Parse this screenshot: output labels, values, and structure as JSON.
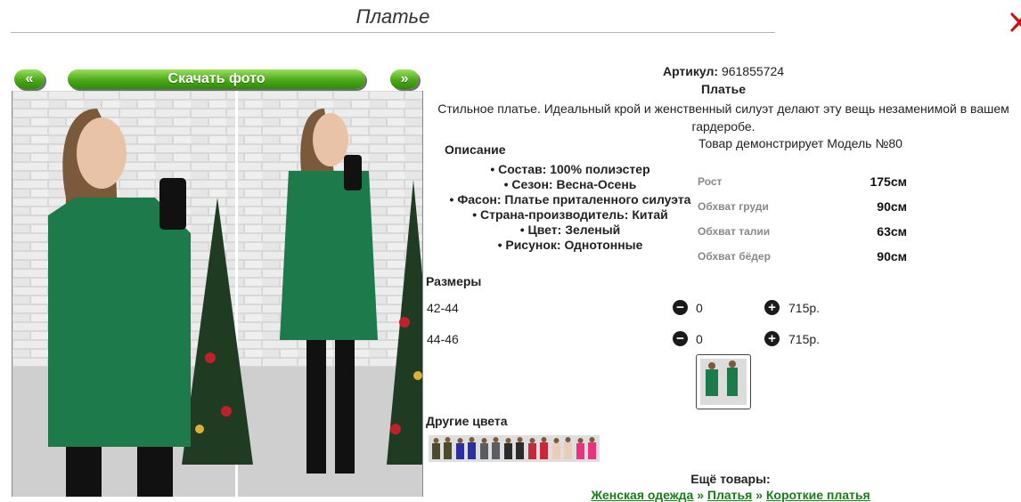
{
  "page": {
    "title": "Платье"
  },
  "photo_nav": {
    "prev_label": "«",
    "download_label": "Скачать фото",
    "next_label": "»"
  },
  "product": {
    "sku_label": "Артикул:",
    "sku_value": "961855724",
    "name": "Платье",
    "description": "Стильное платье. Идеальный крой и женственный силуэт делают эту вещь незаменимой в вашем гардеробе."
  },
  "details": {
    "title": "Описание",
    "features": [
      "Состав: 100% полиэстер",
      "Сезон: Весна-Осень",
      "Фасон: Платье приталенного силуэта",
      "Страна-производитель: Китай",
      "Цвет: Зеленый",
      "Рисунок: Однотонные"
    ]
  },
  "model": {
    "note": "Товар демонстрирует Модель №80",
    "measurements": [
      {
        "label": "Рост",
        "value": "175см"
      },
      {
        "label": "Обхват груди",
        "value": "90см"
      },
      {
        "label": "Обхват талии",
        "value": "63см"
      },
      {
        "label": "Обхват бёдер",
        "value": "90см"
      }
    ]
  },
  "sizes": {
    "title": "Размеры",
    "rows": [
      {
        "name": "42-44",
        "minus": "−",
        "qty": "0",
        "plus": "+",
        "price": "715р."
      },
      {
        "name": "44-46",
        "minus": "−",
        "qty": "0",
        "plus": "+",
        "price": "715р."
      }
    ]
  },
  "other_colors": {
    "title": "Другие цвета",
    "colors": [
      "#4b4a2c",
      "#2b2fa0",
      "#5a5d62",
      "#2b2b2b",
      "#c7283a",
      "#e9cdb8",
      "#e8347f"
    ]
  },
  "more": {
    "title": "Ещё товары:",
    "crumbs": [
      "Женская одежда",
      "Платья",
      "Короткие платья"
    ],
    "separator": "»"
  },
  "colors": {
    "dress_green": "#1d7a4a",
    "button_green": "#4aa81a",
    "close_red": "#cc1111"
  }
}
